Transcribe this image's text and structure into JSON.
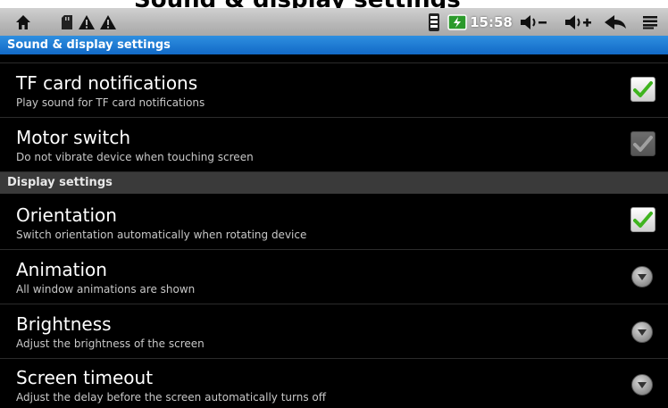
{
  "header": {
    "cut_title": "Sound & display settings"
  },
  "statusbar": {
    "time": "15:58",
    "icons": [
      "home-icon",
      "sd-card-icon",
      "warning-icon",
      "warning-icon",
      "signal-icon",
      "battery-icon",
      "volume-down-icon",
      "volume-up-icon",
      "back-icon",
      "menu-icon"
    ]
  },
  "titlebar": {
    "title": "Sound & display settings"
  },
  "items": [
    {
      "title": "TF card notifications",
      "summary": "Play sound for TF card notifications",
      "widget": "checkbox",
      "checked": true,
      "enabled": true
    },
    {
      "title": "Motor switch",
      "summary": "Do not vibrate device when touching screen",
      "widget": "checkbox",
      "checked": true,
      "enabled": false
    },
    {
      "title": "Orientation",
      "summary": "Switch orientation automatically when rotating device",
      "widget": "checkbox",
      "checked": true,
      "enabled": true
    },
    {
      "title": "Animation",
      "summary": "All window animations are shown",
      "widget": "dropdown"
    },
    {
      "title": "Brightness",
      "summary": "Adjust the brightness of the screen",
      "widget": "dropdown"
    },
    {
      "title": "Screen timeout",
      "summary": "Adjust the delay before the screen automatically turns off",
      "widget": "dropdown"
    }
  ],
  "sections": {
    "display": "Display settings"
  },
  "colors": {
    "titlebar": "#1b78d6",
    "check": "#3fb41f",
    "background": "#000000"
  }
}
